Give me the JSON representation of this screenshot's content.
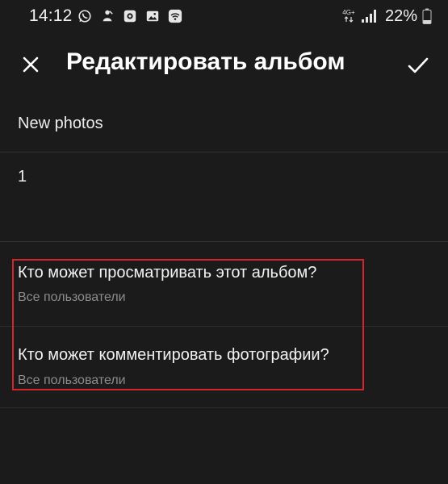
{
  "status_bar": {
    "time": "14:12",
    "network_label": "4G+",
    "battery_percent": "22%",
    "icons_left": [
      "whatsapp-icon",
      "notification-icon",
      "camera-app-icon",
      "gallery-icon",
      "wifi-icon"
    ],
    "icons_right": [
      "network-4g-icon",
      "signal-icon",
      "battery-icon"
    ]
  },
  "toolbar": {
    "close_icon": "close-icon",
    "title": "Редактировать альбом",
    "confirm_icon": "check-icon"
  },
  "album": {
    "title_value": "New photos",
    "description_value": "1"
  },
  "settings": {
    "view": {
      "label": "Кто может просматривать этот альбом?",
      "value": "Все пользователи"
    },
    "comment": {
      "label": "Кто может комментировать фотографии?",
      "value": "Все пользователи"
    }
  },
  "colors": {
    "background": "#1b1b1b",
    "highlight": "#d3252c",
    "text_primary": "#f2f2f2",
    "text_secondary": "#8c8c8c"
  }
}
